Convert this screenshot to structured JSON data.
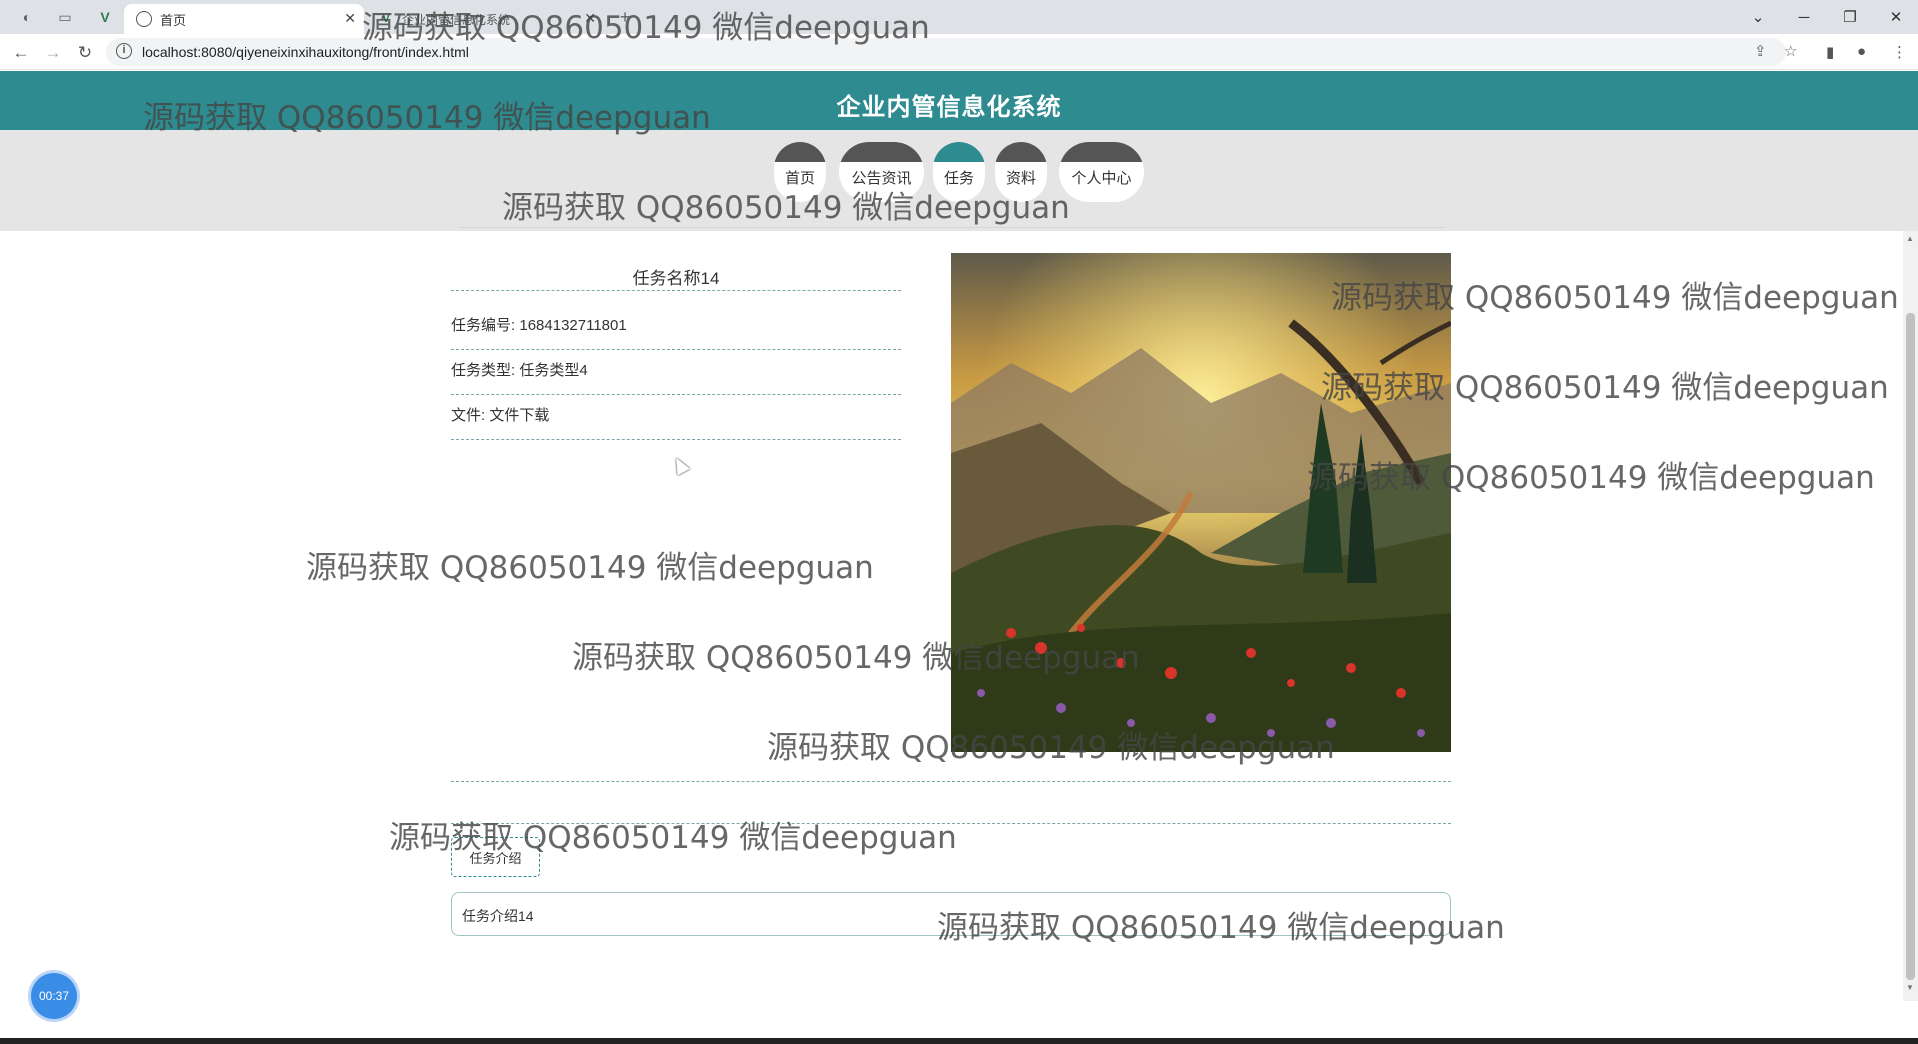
{
  "browser": {
    "tabs": [
      {
        "title": "",
        "icon": "globe-icon",
        "active": false
      },
      {
        "title": "",
        "icon": "blank-page-icon",
        "active": false
      },
      {
        "title": "",
        "icon": "vue-logo-icon",
        "active": false
      },
      {
        "title": "首页",
        "icon": "globe-icon",
        "active": true
      },
      {
        "title": "企业内管信息化系统",
        "icon": "vue-logo-icon",
        "active": false
      }
    ],
    "new_tab_glyph": "+",
    "url": "localhost:8080/qiyeneixinxihauxitong/front/index.html",
    "window_controls": [
      "⌄",
      "─",
      "❐",
      "✕"
    ]
  },
  "site": {
    "title": "企业内管信息化系统",
    "nav": [
      {
        "label": "首页",
        "active": false
      },
      {
        "label": "公告资讯",
        "active": false
      },
      {
        "label": "任务",
        "active": true
      },
      {
        "label": "资料",
        "active": false
      },
      {
        "label": "个人中心",
        "active": false
      }
    ]
  },
  "detail": {
    "name": "任务名称14",
    "fields": [
      {
        "label": "任务编号",
        "value": "1684132711801"
      },
      {
        "label": "任务类型",
        "value": "任务类型4"
      },
      {
        "label": "文件",
        "value": "文件下载"
      }
    ],
    "image_alt": "mountain valley landscape with wildflowers"
  },
  "intro": {
    "tab_label": "任务介绍",
    "content": "任务介绍14"
  },
  "recorder": {
    "time": "00:37"
  },
  "watermark": {
    "text": "源码获取 QQ86050149 微信deepguan"
  },
  "colors": {
    "brand_teal": "#2e8b8f",
    "nav_strip": "#e5e5e5",
    "recorder_blue": "#3a8de6"
  }
}
